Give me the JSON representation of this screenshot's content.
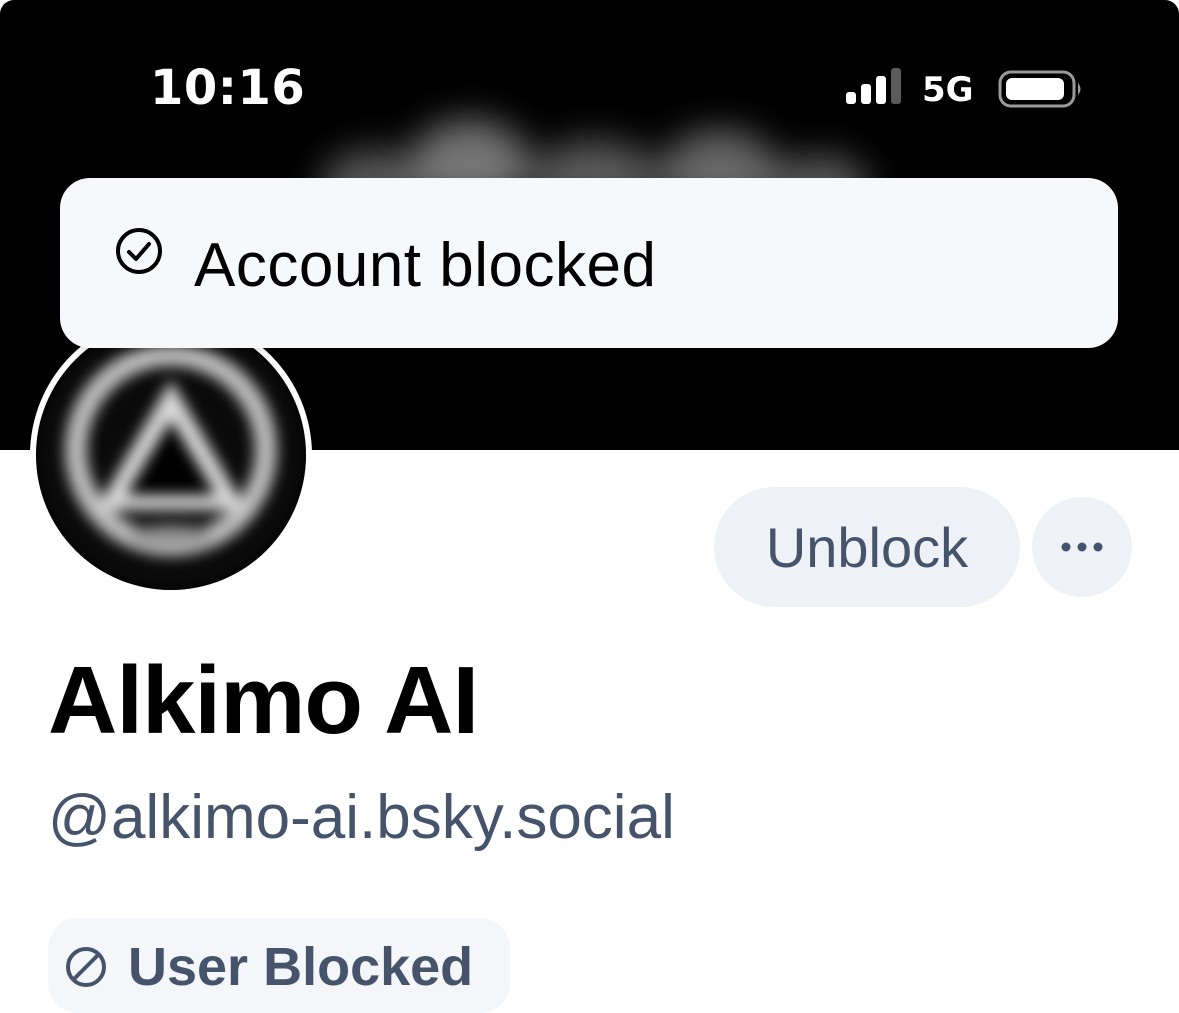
{
  "status_bar": {
    "time": "10:16",
    "network": "5G",
    "signal_icon": "cellular-signal-icon",
    "battery_icon": "battery-icon"
  },
  "toast": {
    "icon": "check-circle-icon",
    "message": "Account blocked"
  },
  "profile": {
    "avatar_icon": "avatar",
    "display_name": "Alkimo AI",
    "handle": "@alkimo-ai.bsky.social",
    "unblock_label": "Unblock",
    "more_icon": "ellipsis-icon",
    "blocked_badge": {
      "icon": "blocked-icon",
      "label": "User Blocked"
    }
  },
  "colors": {
    "banner": "#000000",
    "button_bg": "#eef1f5",
    "secondary_text": "#46546b",
    "toast_bg": "#f7f8fa"
  }
}
